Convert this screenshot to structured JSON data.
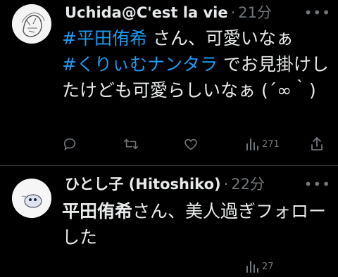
{
  "tweets": [
    {
      "display_name": "Uchida@C'est la vie",
      "dot": "·",
      "time": "21分",
      "more": "•••",
      "body": {
        "tag1": "#平田侑希",
        "text1": " さん、可愛いなぁ",
        "tag2": "#くりぃむナンタラ",
        "text2": " でお見掛けしたけども可愛らしいなぁ (´∞｀)"
      },
      "actions": {
        "reply_count": "",
        "retweet_count": "",
        "like_count": "",
        "views_count": "271"
      }
    },
    {
      "display_name": "ひとし子 (Hitoshiko)",
      "dot": "·",
      "time": "22分",
      "more": "•••",
      "body": {
        "name_bold": "平田侑希",
        "text": "さん、美人過ぎフォローした"
      },
      "actions": {
        "views_count": "27"
      }
    }
  ],
  "colors": {
    "background": "#000000",
    "text": "#e7e9ea",
    "secondary": "#71767b",
    "hashtag": "#1d9bf0",
    "divider": "#2f3336"
  },
  "icons": [
    "reply-icon",
    "retweet-icon",
    "like-icon",
    "views-icon",
    "share-icon",
    "more-icon"
  ]
}
